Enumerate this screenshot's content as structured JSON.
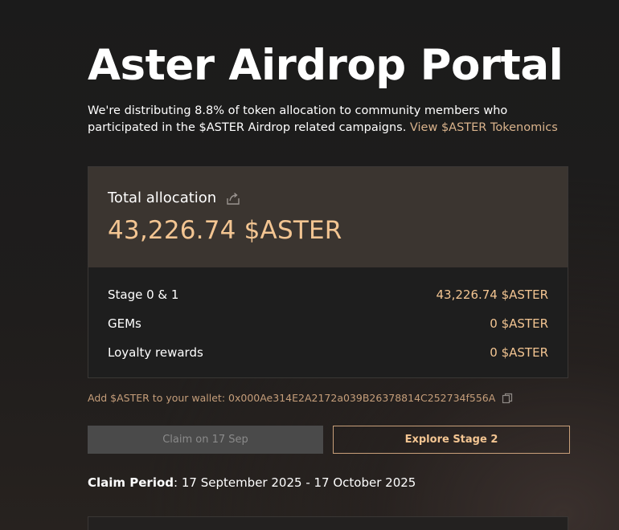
{
  "page": {
    "title": "Aster Airdrop Portal",
    "intro_text": "We're distributing 8.8% of token allocation to community members who participated in the $ASTER Airdrop related campaigns.",
    "intro_link": "View $ASTER Tokenomics"
  },
  "allocation": {
    "title": "Total allocation",
    "share_icon": "share-icon",
    "amount": "43,226.74 $ASTER",
    "rows": [
      {
        "label": "Stage 0 & 1",
        "value": "43,226.74 $ASTER"
      },
      {
        "label": "GEMs",
        "value": "0 $ASTER"
      },
      {
        "label": "Loyalty rewards",
        "value": "0 $ASTER"
      }
    ]
  },
  "wallet": {
    "text": "Add $ASTER to your wallet: 0x000Ae314E2A2172a039B26378814C252734f556A",
    "copy_icon": "copy-icon"
  },
  "buttons": {
    "claim_label": "Claim on 17 Sep",
    "explore_label": "Explore Stage 2"
  },
  "claim_period": {
    "label": "Claim Period",
    "value": ": 17 September 2025 - 17 October 2025"
  },
  "colors": {
    "accent": "#f3c592",
    "link": "#d9b38c",
    "card_top": "#3b3530",
    "disabled_button": "#4a4a4a"
  }
}
